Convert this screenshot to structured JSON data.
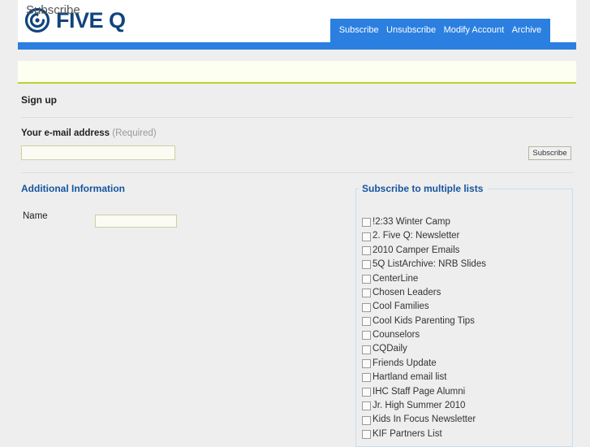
{
  "brand": {
    "logo_text": "FIVE Q",
    "logo_icon": "five-q-swirl-icon",
    "logo_color": "#10457e",
    "accent_blue": "#2b7fe0",
    "accent_green": "#b8d330"
  },
  "nav": {
    "items": [
      {
        "label": "Subscribe"
      },
      {
        "label": "Unsubscribe"
      },
      {
        "label": "Modify Account"
      },
      {
        "label": "Archive"
      }
    ]
  },
  "page": {
    "title": "Subscribe"
  },
  "signup": {
    "heading": "Sign up",
    "email_label": "Your e-mail address",
    "email_required_note": "(Required)",
    "email_value": "",
    "email_placeholder": "",
    "submit_label": "Subscribe"
  },
  "additional_information": {
    "heading": "Additional Information",
    "fields": [
      {
        "label": "Name",
        "value": "",
        "placeholder": ""
      }
    ]
  },
  "multiple_lists": {
    "heading": "Subscribe to multiple lists",
    "items": [
      {
        "label": "!2:33 Winter Camp",
        "checked": false
      },
      {
        "label": "2. Five Q: Newsletter",
        "checked": false
      },
      {
        "label": "2010 Camper Emails",
        "checked": false
      },
      {
        "label": "5Q ListArchive: NRB Slides",
        "checked": false
      },
      {
        "label": "CenterLine",
        "checked": false
      },
      {
        "label": "Chosen Leaders",
        "checked": false
      },
      {
        "label": "Cool Families",
        "checked": false
      },
      {
        "label": "Cool Kids Parenting Tips",
        "checked": false
      },
      {
        "label": "Counselors",
        "checked": false
      },
      {
        "label": "CQDaily",
        "checked": false
      },
      {
        "label": "Friends Update",
        "checked": false
      },
      {
        "label": "Hartland email list",
        "checked": false
      },
      {
        "label": "IHC Staff Page Alumni",
        "checked": false
      },
      {
        "label": "Jr. High Summer 2010",
        "checked": false
      },
      {
        "label": "Kids In Focus Newsletter",
        "checked": false
      },
      {
        "label": "KIF Partners List",
        "checked": false
      }
    ]
  }
}
